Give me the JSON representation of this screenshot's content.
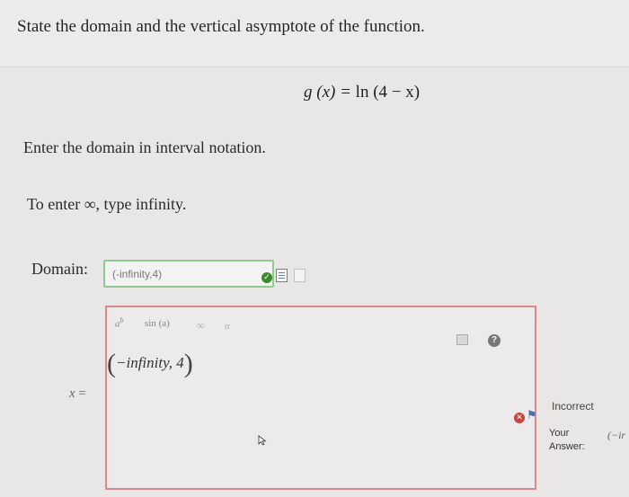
{
  "question": "State the domain and the vertical asymptote of the function.",
  "function_lhs": "g (x) = ",
  "function_ln": "ln",
  "function_arg": " (4 − x)",
  "prompt_domain": "Enter the domain in interval notation.",
  "prompt_infinity": "To enter ∞, type infinity.",
  "domain": {
    "label": "Domain:",
    "value": "(-infinity,4)",
    "status_color": "#3c8a2e"
  },
  "palette": {
    "power_base": "a",
    "power_exp": "b",
    "sin": "sin (a)",
    "infinity": "∞",
    "alpha": "α"
  },
  "preview": {
    "open": "(",
    "text": "−infinity, 4",
    "close": ")"
  },
  "asymptote": {
    "label_var": "x",
    "label_eq": " ="
  },
  "feedback": {
    "status": "Incorrect",
    "your_answer_label_1": "Your",
    "your_answer_label_2": "Answer:",
    "your_answer_value": "(−ir",
    "error_color": "#c8443e",
    "accent_border": "#d9898a"
  },
  "icons": [
    "check-icon",
    "document-icon",
    "calculator-icon",
    "help-icon",
    "error-icon",
    "flag-icon",
    "cursor-icon"
  ]
}
